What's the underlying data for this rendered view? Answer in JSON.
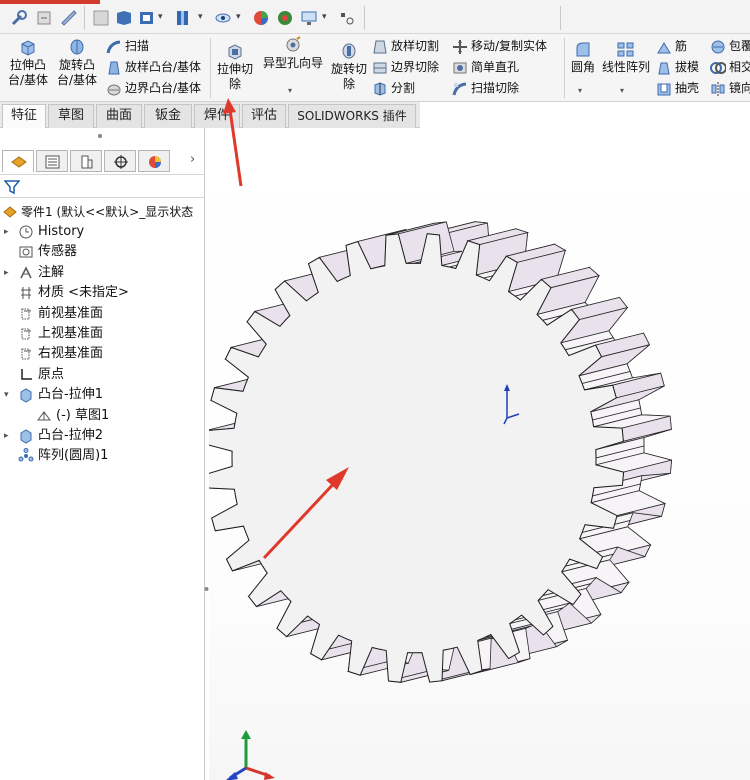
{
  "ribbon": {
    "extrude_boss": "拉伸凸\n台/基体",
    "revolve_boss": "旋转凸\n台/基体",
    "sweep": "扫描",
    "loft_boss": "放样凸台/基体",
    "boundary_boss": "边界凸台/基体",
    "extrude_cut": "拉伸切\n除",
    "hole_wizard": "异型孔向导",
    "revolve_cut": "旋转切\n除",
    "loft_cut": "放样切割",
    "boundary_cut": "边界切除",
    "split": "分割",
    "move_copy": "移动/复制实体",
    "simple_hole": "简单直孔",
    "sweep_cut": "扫描切除",
    "fillet": "圆角",
    "linear_pattern": "线性阵列",
    "rib": "筋",
    "draft": "拔模",
    "shell": "抽壳",
    "wrap": "包覆",
    "intersect": "相交",
    "mirror": "镜向"
  },
  "tabs": [
    "特征",
    "草图",
    "曲面",
    "钣金",
    "焊件",
    "评估",
    "SOLIDWORKS 插件"
  ],
  "active_tab": "特征",
  "tree": {
    "root": "零件1 (默认<<默认>_显示状态",
    "items": [
      {
        "label": "History",
        "expander": "▸",
        "icon": "history-icon"
      },
      {
        "label": "传感器",
        "expander": "",
        "icon": "sensor-icon"
      },
      {
        "label": "注解",
        "expander": "▸",
        "icon": "annotation-icon"
      },
      {
        "label": "材质 <未指定>",
        "expander": "",
        "icon": "material-icon"
      },
      {
        "label": "前视基准面",
        "expander": "",
        "icon": "plane-icon"
      },
      {
        "label": "上视基准面",
        "expander": "",
        "icon": "plane-icon"
      },
      {
        "label": "右视基准面",
        "expander": "",
        "icon": "plane-icon"
      },
      {
        "label": "原点",
        "expander": "",
        "icon": "origin-icon"
      },
      {
        "label": "凸台-拉伸1",
        "expander": "▾",
        "icon": "boss-extrude-icon"
      },
      {
        "label": "(-) 草图1",
        "expander": "",
        "icon": "sketch-icon"
      },
      {
        "label": "凸台-拉伸2",
        "expander": "▸",
        "icon": "boss-extrude-icon"
      },
      {
        "label": "阵列(圆周)1",
        "expander": "",
        "icon": "circular-pattern-icon"
      }
    ]
  },
  "model": {
    "teeth": 32,
    "annotation_color": "#e0392b",
    "gear_side_color": "#e9e1ec",
    "gear_face_color": "#f2f2f2"
  }
}
